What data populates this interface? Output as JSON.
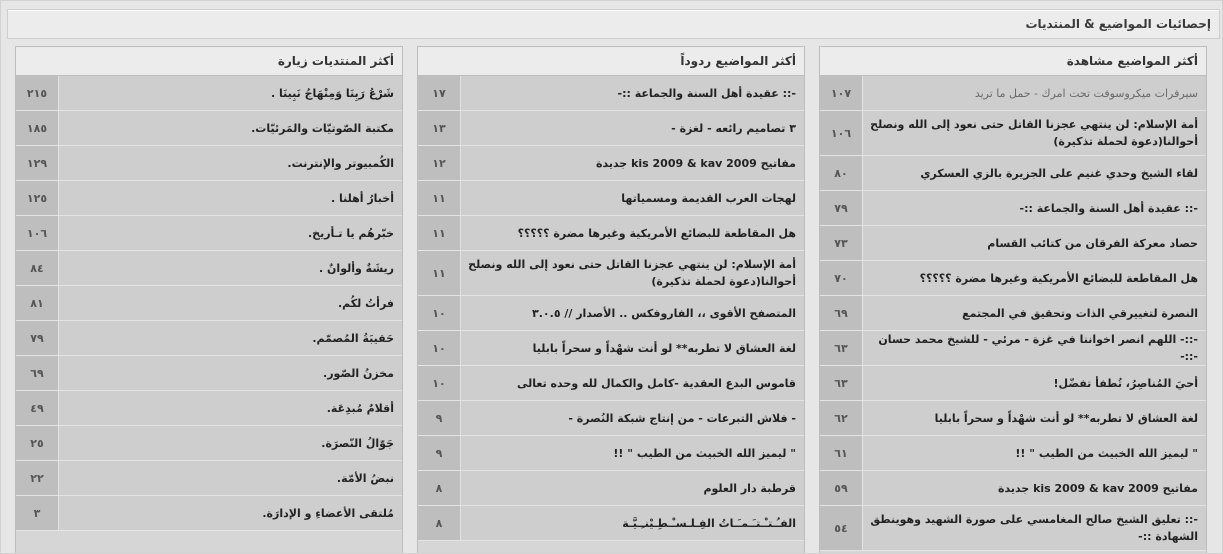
{
  "header": {
    "title": "إحصائيات المواضيع & المنتديات"
  },
  "columns": [
    {
      "title": "أكثر المنتديات زيارة",
      "rows": [
        {
          "label": "شَرْعُ رَبِنَا وَمِنْهَاجُ نَبِينَا .",
          "count": "٢١٥"
        },
        {
          "label": "مكتبة الصّوتيّات والمَرئيّات.",
          "count": "١٨٥"
        },
        {
          "label": "الكُمبيوتر والإنترنت.",
          "count": "١٢٩"
        },
        {
          "label": "أخبارُ أهلنا .",
          "count": "١٢٥"
        },
        {
          "label": "خبّرهُم يا تـأريخ.",
          "count": "١٠٦"
        },
        {
          "label": "ريشَةٌ وألوانٌ .",
          "count": "٨٤"
        },
        {
          "label": "فرأتُ لكُم.",
          "count": "٨١"
        },
        {
          "label": "حَقيبَةُ المُصمّم.",
          "count": "٧٩"
        },
        {
          "label": "مخزنُ الصّور.",
          "count": "٦٩"
        },
        {
          "label": "أقلامٌ مُبدِعَة.",
          "count": "٤٩"
        },
        {
          "label": "جَوّالُ النّصرَة.",
          "count": "٢٥"
        },
        {
          "label": "نبضُ الأمّة.",
          "count": "٢٢"
        },
        {
          "label": "مُلتقى الأعضاءِ و الإدارَة.",
          "count": "٣"
        }
      ]
    },
    {
      "title": "أكثر المواضيع ردوداً",
      "rows": [
        {
          "label": "-:: عقيدة أهل السنة والجماعة ::-",
          "count": "١٧"
        },
        {
          "label": "٣ تصاميم رائعه - لغزة -",
          "count": "١٣"
        },
        {
          "label": "مفاتيح kis 2009 & kav 2009 جديدة",
          "count": "١٢"
        },
        {
          "label": "لهجات العرب القديمة ومسمياتها",
          "count": "١١"
        },
        {
          "label": "هل المقاطعة للبضائع الأمريكية وغيرها مضرة ؟؟؟؟؟",
          "count": "١١"
        },
        {
          "label": "أمة الإسلام: لن ينتهي عجزنا القاتل حتى نعود إلى الله ونصلح أحوالنا(دعوة لحملة تذكيرة)",
          "count": "١١",
          "tall": true
        },
        {
          "label": "المتصفح الأقوى ،، الفاروفكس .. الأصدار // ٣.٠.٥",
          "count": "١٠"
        },
        {
          "label": "لغة العشاق لا تطربه** لو أنت شهْداً و سحراً بابليا",
          "count": "١٠"
        },
        {
          "label": "قاموس البدع العقدية -كامل والكمال لله وحده تعالى",
          "count": "١٠"
        },
        {
          "label": "- فلاش التبرعات - من إنتاج شبكة النُصرة -",
          "count": "٩"
        },
        {
          "label": "\" ليميز الله الخبيث من الطيب \" !!",
          "count": "٩"
        },
        {
          "label": "قرطبة دار العلوم",
          "count": "٨"
        },
        {
          "label": "الفـُـتـْـتـَـمـَـاتُ الفِـلـسـْـطِـيْنـِـيَّـة",
          "count": "٨"
        }
      ]
    },
    {
      "title": "أكثر المواضيع مشاهدة",
      "rows": [
        {
          "label": "سيرفرات ميكروسوفت تحت امرك - حمل ما تريد",
          "count": "١٠٧",
          "muted": true
        },
        {
          "label": "أمة الإسلام: لن ينتهي عجزنا القاتل حتى نعود إلى الله ونصلح أحوالنا(دعوة لحملة تذكيرة)",
          "count": "١٠٦",
          "tall": true
        },
        {
          "label": "لقاء الشيخ وحدي غنيم على الجزيرة بالزي العسكري",
          "count": "٨٠"
        },
        {
          "label": "-:: عقيدة أهل السنة والجماعة ::-",
          "count": "٧٩"
        },
        {
          "label": "حصاد معركة الفرقان من كتائب القسام",
          "count": "٧٣"
        },
        {
          "label": "هل المقاطعة للبضائع الأمريكية وغيرها مضرة ؟؟؟؟؟",
          "count": "٧٠"
        },
        {
          "label": "النصرة لتغييرقي الذات وتحقيق في المجتمع",
          "count": "٦٩"
        },
        {
          "label": "-::- اللهم انصر اخواننا في غزة - مرئي - للشيخ محمد حسان -::-",
          "count": "٦٣"
        },
        {
          "label": "أحيَ المُناصِرُ، تُطفأ تفضّل!",
          "count": "٦٣"
        },
        {
          "label": "لغة العشاق لا تطربه** لو أنت شهْداً و سحراً بابليا",
          "count": "٦٢"
        },
        {
          "label": "\" ليميز الله الخبيث من الطيب \" !!",
          "count": "٦١"
        },
        {
          "label": "مفاتيح kis 2009 & kav 2009 جديدة",
          "count": "٥٩"
        },
        {
          "label": "-:: تعليق الشيخ صالح المغامسي على صورة الشهيد وهوينطق الشهادة ::-",
          "count": "٥٤",
          "tall": true
        }
      ]
    }
  ]
}
